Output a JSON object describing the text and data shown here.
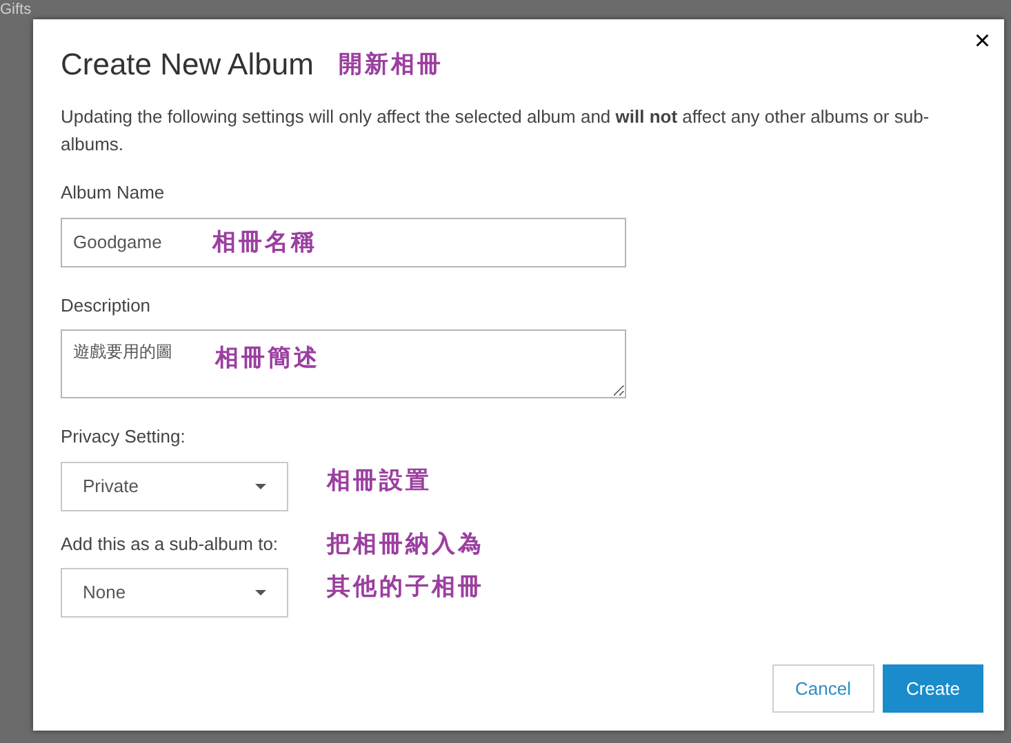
{
  "background_nav": [
    {
      "label": "Gifts"
    }
  ],
  "dialog": {
    "title": "Create New Album",
    "title_annotation": "開新相冊",
    "close": "×",
    "intro": "Updating the following settings will only affect the selected album and **will not** affect any other albums or sub-albums.",
    "fields": [
      {
        "kind": "text",
        "label": "Album Name",
        "value": "Goodgame",
        "annotation": [
          "相冊名稱"
        ]
      },
      {
        "kind": "textarea",
        "label": "Description",
        "value": "遊戲要用的圖",
        "annotation": [
          "相冊簡述"
        ]
      },
      {
        "kind": "select",
        "label": "Privacy Setting:",
        "value": "Private",
        "annotation": [
          "相冊設置"
        ]
      },
      {
        "kind": "select",
        "label": "Add this as a sub-album to:",
        "value": "None",
        "annotation": [
          "把相冊納入為",
          "其他的子相冊"
        ]
      }
    ],
    "buttons": [
      {
        "kind": "secondary",
        "label": "Cancel"
      },
      {
        "kind": "primary",
        "label": "Create"
      }
    ]
  }
}
